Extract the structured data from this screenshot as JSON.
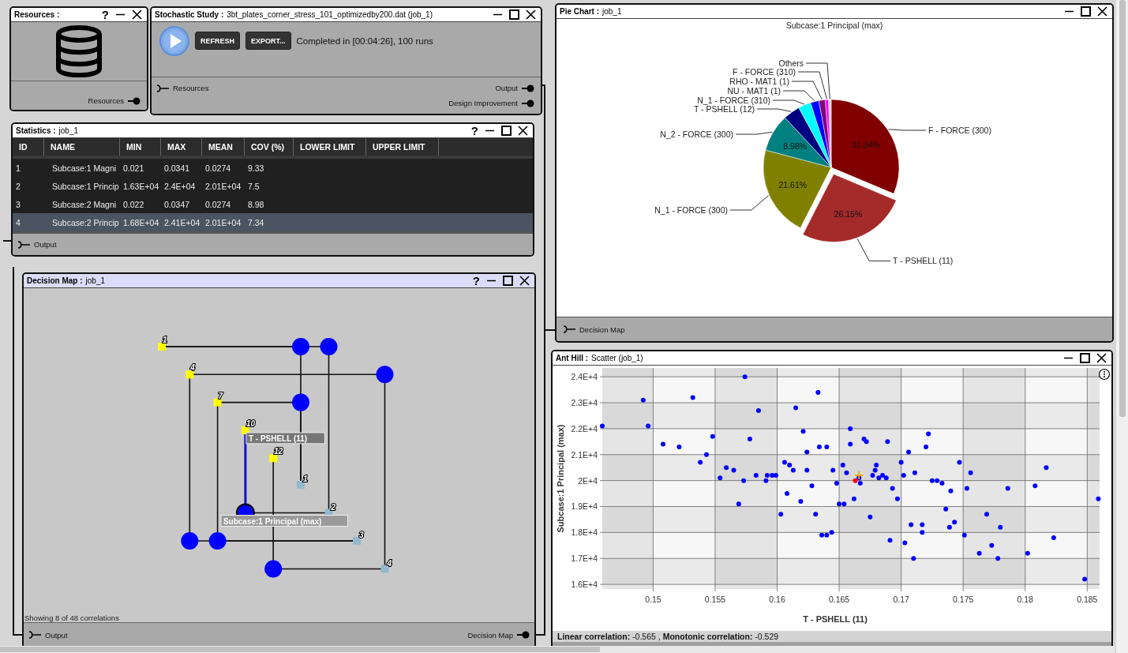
{
  "resources_window": {
    "title": "Resources :",
    "help": "?",
    "ports": [
      {
        "label": "Resources",
        "kind": "output"
      }
    ]
  },
  "stochastic_window": {
    "title": "Stochastic Study :",
    "subtitle": "3bt_plates_corner_stress_101_optimizedby200.dat (job_1)",
    "buttons": [
      "REFRESH",
      "EXPORT..."
    ],
    "status": "Completed in [00:04:26], 100 runs",
    "ports": [
      {
        "label": "Resources",
        "kind": "input"
      },
      {
        "label": "Output",
        "kind": "output"
      },
      {
        "label": "Design Improvement",
        "kind": "output"
      }
    ]
  },
  "statistics_window": {
    "title": "Statistics :",
    "subtitle": "job_1",
    "help": "?",
    "columns": [
      "ID",
      "NAME",
      "MIN",
      "MAX",
      "MEAN",
      "COV (%)",
      "LOWER LIMIT",
      "UPPER LIMIT"
    ],
    "rows": [
      {
        "cells": [
          "1",
          "Subcase:1 Magni",
          "0.021",
          "0.0341",
          "0.0274",
          "9.33"
        ],
        "selected": false
      },
      {
        "cells": [
          "2",
          "Subcase:1 Princip",
          "1.63E+04",
          "2.4E+04",
          "2.01E+04",
          "7.5"
        ],
        "selected": false
      },
      {
        "cells": [
          "3",
          "Subcase:2 Magni",
          "0.022",
          "0.0347",
          "0.0274",
          "8.98"
        ],
        "selected": false
      },
      {
        "cells": [
          "4",
          "Subcase:2 Princip",
          "1.68E+04",
          "2.41E+04",
          "2.01E+04",
          "7.34"
        ],
        "selected": true
      }
    ],
    "ports": [
      {
        "label": "Output",
        "kind": "input"
      }
    ]
  },
  "pie_window": {
    "title": "Pie Chart :",
    "subtitle": "job_1",
    "chart_data": {
      "type": "pie",
      "title": "Subcase:1 Principal (max)",
      "categories": [
        "F - FORCE (300)",
        "T - PSHELL (11)",
        "N_1 - FORCE (300)",
        "N_2 - FORCE (300)",
        "T - PSHELL (12)",
        "N_1 - FORCE (310)",
        "NU - MAT1 (1)",
        "RHO - MAT1 (1)",
        "F - FORCE (310)",
        "Others"
      ],
      "values": [
        31.34,
        26.15,
        21.61,
        8.98,
        4.0,
        3.0,
        2.0,
        1.5,
        0.8,
        0.62
      ],
      "colors": [
        "#800000",
        "#a52a2a",
        "#808000",
        "#008080",
        "#000080",
        "#00ffff",
        "#0000ff",
        "#800080",
        "#ff00ff",
        "#d3d3d3"
      ],
      "value_labels": [
        "31.34%",
        "26.15%",
        "21.61%",
        "8.98%",
        null,
        null,
        null,
        null,
        null,
        null
      ]
    },
    "exploded_slices": [
      false,
      true,
      false,
      false,
      false,
      false,
      false,
      false,
      false,
      false
    ],
    "ports": [
      {
        "label": "Decision Map",
        "kind": "input"
      }
    ]
  },
  "decision_map_window": {
    "title": "Decision Map :",
    "subtitle": "job_1",
    "help": "?",
    "inputs": [
      {
        "label": "1",
        "links": [
          {
            "kind": "row",
            "selected": false
          },
          {
            "kind": "row",
            "selected": false
          },
          {
            "kind": "none"
          },
          {
            "kind": "none"
          }
        ]
      },
      {
        "label": "4",
        "links": [
          {
            "kind": "none"
          },
          {
            "kind": "none"
          },
          {
            "kind": "column",
            "selected": false
          },
          {
            "kind": "row",
            "selected": false
          }
        ]
      },
      {
        "label": "7",
        "links": [
          {
            "kind": "row",
            "selected": false
          },
          {
            "kind": "none"
          },
          {
            "kind": "column",
            "selected": false
          },
          {
            "kind": "none"
          }
        ]
      },
      {
        "label": "10",
        "links": [
          {
            "kind": "none"
          },
          {
            "kind": "column",
            "selected": true,
            "input_tooltip": "T - PSHELL (11)",
            "output_tooltip": "Subcase:1 Principal (max)"
          },
          {
            "kind": "none"
          },
          {
            "kind": "none"
          }
        ]
      },
      {
        "label": "12",
        "links": [
          {
            "kind": "none"
          },
          {
            "kind": "none"
          },
          {
            "kind": "none"
          },
          {
            "kind": "column",
            "selected": false
          }
        ]
      }
    ],
    "outputs": [
      "1",
      "2",
      "3",
      "4"
    ],
    "summary": "Showing 8 of 48 correlations",
    "ports": [
      {
        "label": "Output",
        "kind": "input"
      },
      {
        "label": "Decision Map",
        "kind": "output"
      }
    ]
  },
  "ant_hill_window": {
    "title": "Ant Hill :",
    "subtitle": "Scatter (job_1)",
    "chart_data": {
      "type": "scatter",
      "xlabel": "T - PSHELL (11)",
      "ylabel": "Subcase:1 Principal (max)",
      "xlim": [
        0.1459,
        0.186
      ],
      "ylim": [
        15820,
        24340
      ],
      "xticks": [
        {
          "value": 0.15,
          "label": "0.15"
        },
        {
          "value": 0.155,
          "label": "0.155"
        },
        {
          "value": 0.16,
          "label": "0.16"
        },
        {
          "value": 0.165,
          "label": "0.165"
        },
        {
          "value": 0.17,
          "label": "0.17"
        },
        {
          "value": 0.175,
          "label": "0.175"
        },
        {
          "value": 0.18,
          "label": "0.18"
        },
        {
          "value": 0.185,
          "label": "0.185"
        }
      ],
      "yticks": [
        {
          "value": 16000,
          "label": "1.6E+4"
        },
        {
          "value": 17000,
          "label": "1.7E+4"
        },
        {
          "value": 18000,
          "label": "1.8E+4"
        },
        {
          "value": 19000,
          "label": "1.9E+4"
        },
        {
          "value": 20000,
          "label": "2E+4"
        },
        {
          "value": 21000,
          "label": "2.1E+4"
        },
        {
          "value": 22000,
          "label": "2.2E+4"
        },
        {
          "value": 23000,
          "label": "2.3E+4"
        },
        {
          "value": 24000,
          "label": "2.4E+4"
        }
      ],
      "x": [
        0.1459,
        0.1492,
        0.1496,
        0.1508,
        0.1521,
        0.1532,
        0.1538,
        0.1543,
        0.1548,
        0.1554,
        0.1559,
        0.1565,
        0.1573,
        0.1569,
        0.1574,
        0.1578,
        0.1585,
        0.1583,
        0.1591,
        0.1592,
        0.1596,
        0.1599,
        0.1603,
        0.1606,
        0.1608,
        0.161,
        0.1613,
        0.1615,
        0.1619,
        0.1621,
        0.1624,
        0.1624,
        0.1628,
        0.1631,
        0.1633,
        0.1634,
        0.1636,
        0.164,
        0.164,
        0.1644,
        0.1645,
        0.1648,
        0.165,
        0.1653,
        0.1654,
        0.1656,
        0.1659,
        0.1659,
        0.1662,
        0.1666,
        0.1667,
        0.167,
        0.1672,
        0.1675,
        0.1677,
        0.1679,
        0.168,
        0.1682,
        0.1685,
        0.1688,
        0.1689,
        0.1691,
        0.1693,
        0.1697,
        0.17,
        0.1702,
        0.1703,
        0.1706,
        0.1708,
        0.171,
        0.1711,
        0.1717,
        0.1717,
        0.172,
        0.1722,
        0.1725,
        0.1729,
        0.1733,
        0.1736,
        0.174,
        0.1739,
        0.1743,
        0.1747,
        0.1751,
        0.1753,
        0.1756,
        0.1763,
        0.1769,
        0.1773,
        0.1778,
        0.178,
        0.1786,
        0.1802,
        0.1808,
        0.1817,
        0.1823,
        0.1848,
        0.1859,
        0.1663,
        0.1666
      ],
      "grid": true,
      "series": [
        {
          "color": "#0000ff",
          "marker": "circle",
          "values": [
            22100,
            23100,
            22100,
            21400,
            21300,
            23200,
            20700,
            21000,
            21700,
            20100,
            20500,
            20400,
            20000,
            19100,
            24000,
            21600,
            22700,
            20200,
            20000,
            20200,
            20200,
            20200,
            18700,
            20700,
            19500,
            20600,
            20400,
            22800,
            19200,
            21900,
            20400,
            21100,
            19800,
            18700,
            23400,
            21300,
            17900,
            17900,
            21300,
            18000,
            20400,
            19900,
            19100,
            20600,
            19100,
            20300,
            22000,
            21400,
            19300,
            20100,
            19900,
            21600,
            21500,
            18600,
            20200,
            20400,
            20600,
            20100,
            20200,
            20100,
            21500,
            17700,
            19700,
            19300,
            20700,
            20200,
            17600,
            21100,
            18300,
            17000,
            20300,
            18000,
            18300,
            21300,
            21800,
            20000,
            20000,
            19900,
            18900,
            19600,
            18200,
            18400,
            20700,
            17900,
            19700,
            20300,
            17200,
            18700,
            17500,
            17000,
            18200,
            19700,
            17200,
            19800,
            20500,
            17800,
            16200,
            19300,
            null,
            null
          ]
        },
        {
          "color": "#ff0000",
          "marker": "circle",
          "values": [
            null,
            null,
            null,
            null,
            null,
            null,
            null,
            null,
            null,
            null,
            null,
            null,
            null,
            null,
            null,
            null,
            null,
            null,
            null,
            null,
            null,
            null,
            null,
            null,
            null,
            null,
            null,
            null,
            null,
            null,
            null,
            null,
            null,
            null,
            null,
            null,
            null,
            null,
            null,
            null,
            null,
            null,
            null,
            null,
            null,
            null,
            null,
            null,
            null,
            null,
            null,
            null,
            null,
            null,
            null,
            null,
            null,
            null,
            null,
            null,
            null,
            null,
            null,
            null,
            null,
            null,
            null,
            null,
            null,
            null,
            null,
            null,
            null,
            null,
            null,
            null,
            null,
            null,
            null,
            null,
            null,
            null,
            null,
            null,
            null,
            null,
            null,
            null,
            null,
            null,
            null,
            null,
            null,
            null,
            null,
            null,
            null,
            null,
            20000,
            null
          ]
        },
        {
          "color": "#ffa500",
          "marker": "cross",
          "values": [
            null,
            null,
            null,
            null,
            null,
            null,
            null,
            null,
            null,
            null,
            null,
            null,
            null,
            null,
            null,
            null,
            null,
            null,
            null,
            null,
            null,
            null,
            null,
            null,
            null,
            null,
            null,
            null,
            null,
            null,
            null,
            null,
            null,
            null,
            null,
            null,
            null,
            null,
            null,
            null,
            null,
            null,
            null,
            null,
            null,
            null,
            null,
            null,
            null,
            null,
            null,
            null,
            null,
            null,
            null,
            null,
            null,
            null,
            null,
            null,
            null,
            null,
            null,
            null,
            null,
            null,
            null,
            null,
            null,
            null,
            null,
            null,
            null,
            null,
            null,
            null,
            null,
            null,
            null,
            null,
            null,
            null,
            null,
            null,
            null,
            null,
            null,
            null,
            null,
            null,
            null,
            null,
            null,
            null,
            null,
            null,
            null,
            null,
            null,
            20200
          ]
        }
      ]
    },
    "footer": "**Linear correlation:**  -0.565 , **Monotonic correlation:**  -0.529"
  }
}
